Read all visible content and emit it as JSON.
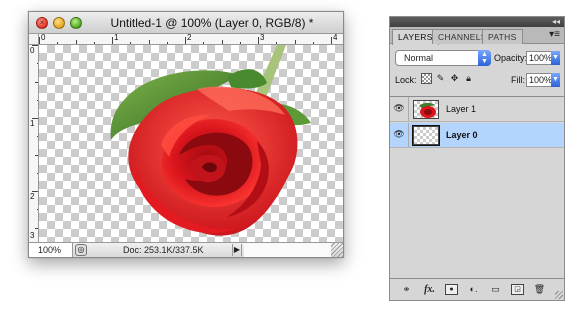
{
  "document_window": {
    "title": "Untitled-1 @ 100% (Layer 0, RGB/8) *",
    "traffic_lights": {
      "close_icon": "close-icon",
      "minimize_icon": "minimize-icon",
      "zoom_icon": "zoom-icon"
    },
    "ruler_horizontal": [
      "0",
      "1",
      "2",
      "3",
      "4"
    ],
    "ruler_vertical": [
      "0",
      "1",
      "2",
      "3"
    ],
    "zoom_level": "100%",
    "doc_size": "Doc: 253.1K/337.5K",
    "image_subject": "red-rose-on-transparent-background"
  },
  "layers_panel": {
    "tabs": [
      {
        "label": "LAYERS",
        "active": true
      },
      {
        "label": "CHANNELS",
        "active": false
      },
      {
        "label": "PATHS",
        "active": false
      }
    ],
    "blend_mode": "Normal",
    "opacity_label": "Opacity:",
    "opacity_value": "100%",
    "lock_label": "Lock:",
    "fill_label": "Fill:",
    "fill_value": "100%",
    "layers": [
      {
        "name": "Layer 1",
        "visible": true,
        "selected": false,
        "thumbnail": "rose"
      },
      {
        "name": "Layer 0",
        "visible": true,
        "selected": true,
        "thumbnail": "transparent"
      }
    ],
    "footer_icons": [
      "link-layers-icon",
      "layer-style-fx-icon",
      "add-mask-icon",
      "adjustment-layer-icon",
      "new-group-icon",
      "new-layer-icon",
      "delete-layer-icon"
    ],
    "colors": {
      "selection": "#b3d4fd",
      "accent_blue": "#2a63d8"
    }
  }
}
